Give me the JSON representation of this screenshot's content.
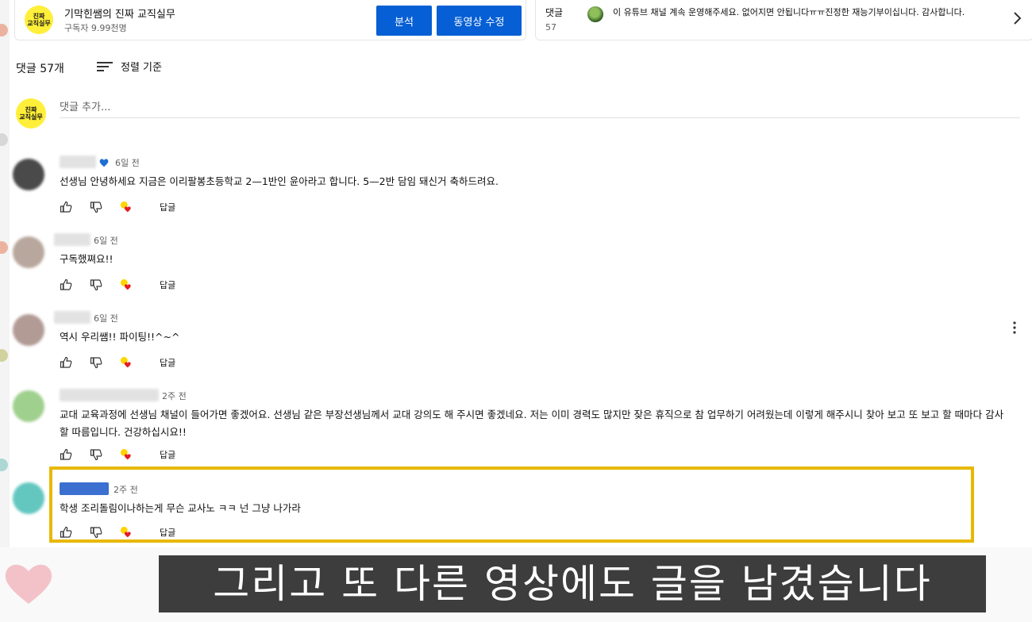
{
  "channel": {
    "avatar_text": "진짜\n교직실무",
    "name": "기막힌쌤의 진짜 교직실무",
    "subscribers": "구독자 9.99천명",
    "analysis_label": "분석",
    "edit_video_label": "동영상 수정"
  },
  "comment_preview": {
    "label": "댓글",
    "count": "57",
    "text": "이 유튜브 채널 계속 운영해주세요. 없어지면 안됩니다ㅠㅠ진정한 재능기부이십니다. 감사합니다."
  },
  "comments_header": {
    "count_label": "댓글 57개",
    "sort_label": "정렬 기준"
  },
  "add_comment": {
    "avatar_text": "진짜\n교직실무",
    "placeholder": "댓글 추가..."
  },
  "comments": [
    {
      "time": "6일 전",
      "heart": true,
      "text": "선생님 안녕하세요 지금은 이리팔봉초등학교 2—1반인 윤아라고 합니다.  5—2반  담임 돼신거 축하드려요.",
      "reply_label": "답글",
      "avatar_color": "#4a4a4a"
    },
    {
      "time": "6일 전",
      "heart": false,
      "text": "구독했쪄요!!",
      "reply_label": "답글",
      "avatar_color": "#b8a79c"
    },
    {
      "time": "6일 전",
      "heart": false,
      "text": "역시 우리쌤!! 파이팅!!^~^",
      "reply_label": "답글",
      "avatar_color": "#b29b95"
    },
    {
      "time": "2주 전",
      "heart": false,
      "text": "교대 교육과정에 선생님 채널이 들어가면 좋겠어요. 선생님 같은 부장선생님께서 교대 강의도 해 주시면 좋겠네요. 저는 이미 경력도 많지만 잦은 휴직으로 참 업무하기 어려웠는데 이렇게 해주시니 찾아 보고 또 보고 할 때마다 감사할 따름입니다. 건강하십시요!!",
      "reply_label": "답글",
      "avatar_color": "#9fd08e"
    },
    {
      "time": "2주 전",
      "heart": false,
      "text": "학생 조리돌림이나하는게 무슨 교사노 ㅋㅋ 넌 그냥 나가라",
      "reply_label": "답글",
      "avatar_color": "#63c7c0"
    }
  ],
  "caption": "그리고 또 다른 영상에도 글을 남겼습니다",
  "colors": {
    "accent_blue": "#065fd4",
    "highlight_border": "#e8b800",
    "caption_bg": "#3d3d3d",
    "channel_avatar": "#ffef3a"
  }
}
